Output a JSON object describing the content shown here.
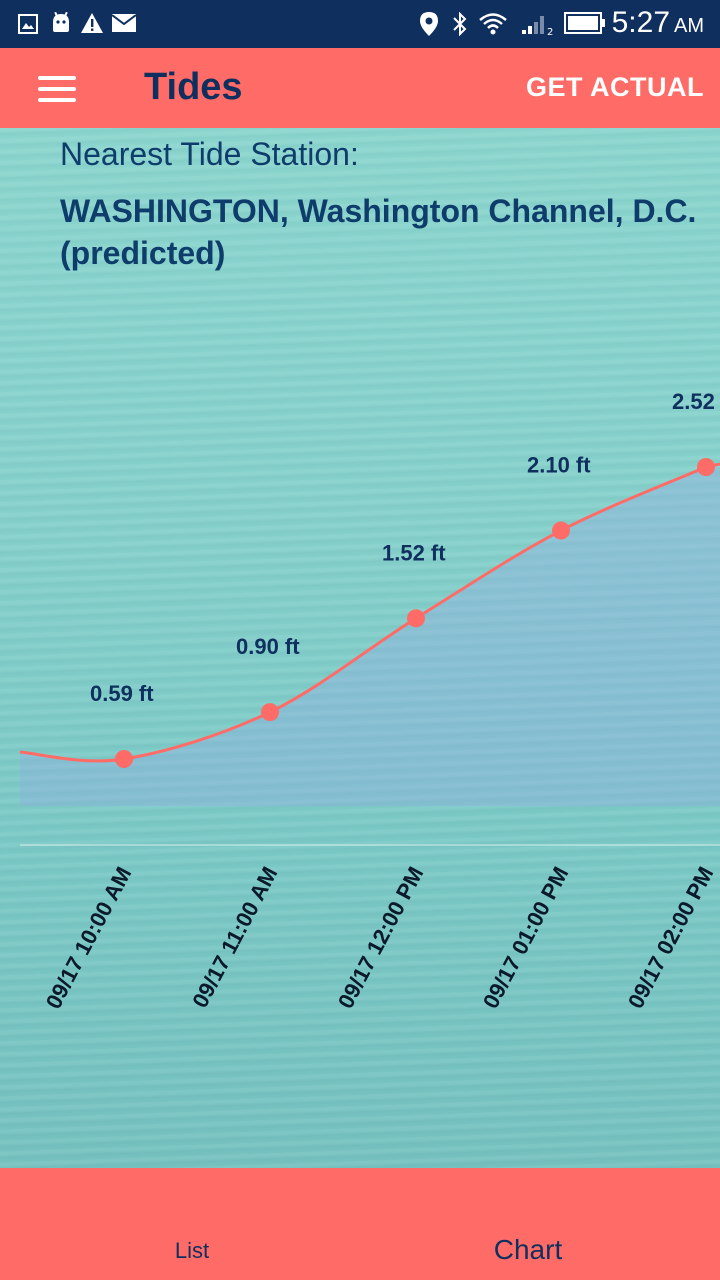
{
  "status_bar": {
    "time": "5:27",
    "ampm": "AM",
    "left_icons": [
      "image-icon",
      "android-icon",
      "warning-icon",
      "mail-icon"
    ],
    "right_icons": [
      "location-icon",
      "bluetooth-icon",
      "wifi-icon",
      "signal-icon",
      "battery-icon"
    ]
  },
  "app_bar": {
    "title": "Tides",
    "action": "GET ACTUAL",
    "bg_color": "#ff6b66",
    "title_color": "#0f2f5f"
  },
  "station": {
    "label": "Nearest Tide Station:",
    "name": "WASHINGTON, Washington Channel, D.C.(predicted)"
  },
  "chart_data": {
    "type": "line",
    "x": [
      "09/17 10:00 AM",
      "09/17 11:00 AM",
      "09/17 12:00 PM",
      "09/17 01:00 PM",
      "09/17 02:00 PM"
    ],
    "values": [
      0.59,
      0.9,
      1.52,
      2.1,
      2.52
    ],
    "point_labels": [
      "0.59 ft",
      "0.90 ft",
      "1.52 ft",
      "2.10 ft",
      "2.52"
    ],
    "line_color": "#ff6b66",
    "ylim": [
      0.59,
      2.52
    ],
    "grid": false,
    "legend": "none"
  },
  "bottom_nav": {
    "tabs": [
      {
        "label": "List",
        "active": false
      },
      {
        "label": "Chart",
        "active": true
      }
    ]
  }
}
